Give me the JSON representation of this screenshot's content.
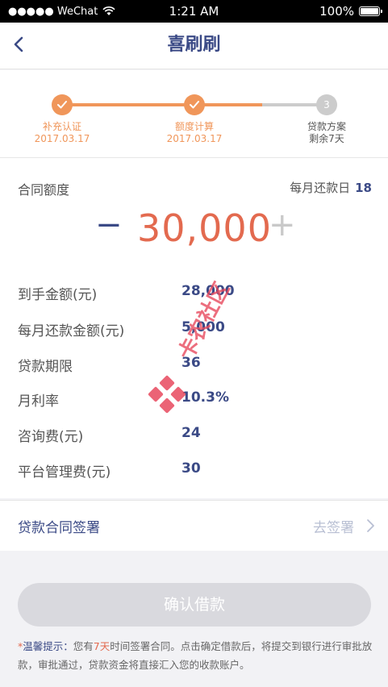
{
  "status_bar": {
    "carrier": "●●●●● WeChat",
    "time": "1:21 AM",
    "battery": "100%"
  },
  "nav": {
    "title": "喜刷刷"
  },
  "steps": [
    {
      "label": "补充认证",
      "sub": "2017.03.17",
      "state": "done"
    },
    {
      "label": "额度计算",
      "sub": "2017.03.17",
      "state": "done"
    },
    {
      "label": "贷款方案",
      "sub": "剩余7天",
      "state": "pending",
      "number": "3"
    }
  ],
  "contract": {
    "label": "合同额度",
    "repay_day_label": "每月还款日",
    "repay_day_value": "18",
    "minus": "−",
    "amount": "30,000",
    "plus": "+"
  },
  "details": [
    {
      "label": "到手金额(元)",
      "value": "28,000"
    },
    {
      "label": "每月还款金额(元)",
      "value": "5,000"
    },
    {
      "label": "贷款期限",
      "value": "36"
    },
    {
      "label": "月利率",
      "value": "10.3%"
    },
    {
      "label": "咨询费(元)",
      "value": "24"
    },
    {
      "label": "平台管理费(元)",
      "value": "30"
    }
  ],
  "sign": {
    "label": "贷款合同签署",
    "action": "去签署"
  },
  "confirm_button": "确认借款",
  "tip": {
    "star": "*",
    "title": "温馨提示：",
    "pre": "您有",
    "days": "7天",
    "post": "时间签署合同。点击确定借款后，将提交到银行进行审批放款，审批通过，贷款资金将直接汇入您的收款账户。"
  },
  "watermark_text": "卡农社区",
  "colors": {
    "brand": "#3b4a86",
    "accent": "#e36a4f",
    "step_done": "#f0965a",
    "step_pending": "#cccccc"
  }
}
